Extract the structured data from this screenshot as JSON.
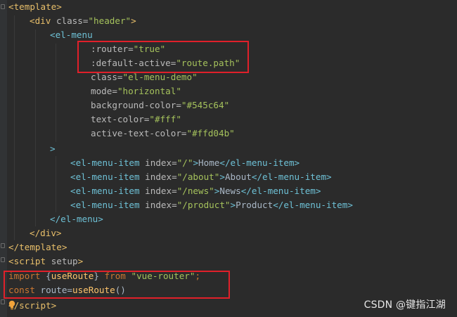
{
  "editor": {
    "lines": {
      "l1": {
        "lt": "<",
        "name": "template",
        "gt": ">"
      },
      "l2": {
        "lt": "<",
        "name": "div",
        "attr": "class",
        "eq": "=",
        "val": "\"header\"",
        "gt": ">"
      },
      "l3": {
        "lt": "<",
        "name": "el-menu"
      },
      "l4": {
        "attr": ":router",
        "eq": "=",
        "val": "\"true\""
      },
      "l5": {
        "attr": ":default-active",
        "eq": "=",
        "val": "\"route.path\""
      },
      "l6": {
        "attr": "class",
        "eq": "=",
        "val": "\"el-menu-demo\""
      },
      "l7": {
        "attr": "mode",
        "eq": "=",
        "val": "\"horizontal\""
      },
      "l8": {
        "attr": "background-color",
        "eq": "=",
        "val": "\"#545c64\""
      },
      "l9": {
        "attr": "text-color",
        "eq": "=",
        "val": "\"#fff\""
      },
      "l10": {
        "attr": "active-text-color",
        "eq": "=",
        "val": "\"#ffd04b\""
      },
      "l11": {
        "gt": ">"
      },
      "l12": {
        "open": "<el-menu-item",
        "attr": "index",
        "eq": "=",
        "val": "\"/\"",
        "gt": ">",
        "text": "Home",
        "close": "</el-menu-item>"
      },
      "l13": {
        "open": "<el-menu-item",
        "attr": "index",
        "eq": "=",
        "val": "\"/about\"",
        "gt": ">",
        "text": "About",
        "close": "</el-menu-item>"
      },
      "l14": {
        "open": "<el-menu-item",
        "attr": "index",
        "eq": "=",
        "val": "\"/news\"",
        "gt": ">",
        "text": "News",
        "close": "</el-menu-item>"
      },
      "l15": {
        "open": "<el-menu-item",
        "attr": "index",
        "eq": "=",
        "val": "\"/product\"",
        "gt": ">",
        "text": "Product",
        "close": "</el-menu-item>"
      },
      "l16": {
        "close": "</el-menu>"
      },
      "l17": {
        "close": "</div>"
      },
      "l18": {
        "close": "</template>"
      },
      "l19": {
        "lt": "<",
        "name": "script",
        "attr": "setup",
        "gt": ">"
      },
      "l20": {
        "kw1": "import",
        "brace_open": "{",
        "fn": "useRoute",
        "brace_close": "}",
        "kw2": "from",
        "val": "\"vue-router\"",
        "semi": ";"
      },
      "l21": {
        "kw": "const",
        "rest": "route=",
        "fn": "useRoute",
        "parens": "()"
      },
      "l22": {
        "lt": "<",
        "name": "/script",
        "gt": ">"
      }
    }
  },
  "colors": {
    "background": "#2b2b2b",
    "tag": "#e8bf6a",
    "custom_element": "#6ec1d6",
    "attribute": "#bababa",
    "string": "#a5c25c",
    "keyword": "#cc7832",
    "function": "#ffc66d",
    "highlight_box": "#e0202a"
  },
  "icons": {
    "bulb": "lightbulb-icon"
  },
  "watermark": {
    "text": "CSDN @键指江湖"
  }
}
